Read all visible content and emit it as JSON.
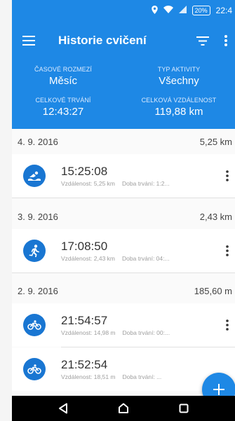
{
  "statusbar": {
    "battery": "20%",
    "time": "22:4"
  },
  "appbar": {
    "title": "Historie cvičení"
  },
  "summary": {
    "range_label": "ČASOVÉ ROZMEZÍ",
    "range_value": "Měsíc",
    "type_label": "TYP AKTIVITY",
    "type_value": "Všechny",
    "duration_label": "CELKOVÉ TRVÁNÍ",
    "duration_value": "12:43:27",
    "distance_label": "CELKOVÁ VZDÁLENOST",
    "distance_value": "119,88 km"
  },
  "groups": [
    {
      "date": "4. 9. 2016",
      "distance": "5,25 km",
      "activities": [
        {
          "icon": "swim-icon",
          "time": "15:25:08",
          "distance": "Vzdálenost: 5,25 km",
          "duration": "Doba trvání: 1:2..."
        }
      ]
    },
    {
      "date": "3. 9. 2016",
      "distance": "2,43 km",
      "activities": [
        {
          "icon": "run-icon",
          "time": "17:08:50",
          "distance": "Vzdálenost: 2,43 km",
          "duration": "Doba trvání: 04:..."
        }
      ]
    },
    {
      "date": "2. 9. 2016",
      "distance": "185,60 m",
      "activities": [
        {
          "icon": "bike-icon",
          "time": "21:54:57",
          "distance": "Vzdálenost: 14,98 m",
          "duration": "Doba trvání: 00:..."
        },
        {
          "icon": "bike-icon",
          "time": "21:52:54",
          "distance": "Vzdálenost: 18,51 m",
          "duration": "Doba trvání: ..."
        }
      ]
    }
  ],
  "colors": {
    "primary": "#1e88e5",
    "icon_circle": "#1976d2"
  },
  "icons": {
    "menu": "menu-icon",
    "filter": "filter-icon",
    "overflow": "more-vert-icon",
    "fab": "plus-icon",
    "nav_back": "back-triangle-icon",
    "nav_home": "home-icon",
    "nav_recent": "recents-square-icon"
  }
}
